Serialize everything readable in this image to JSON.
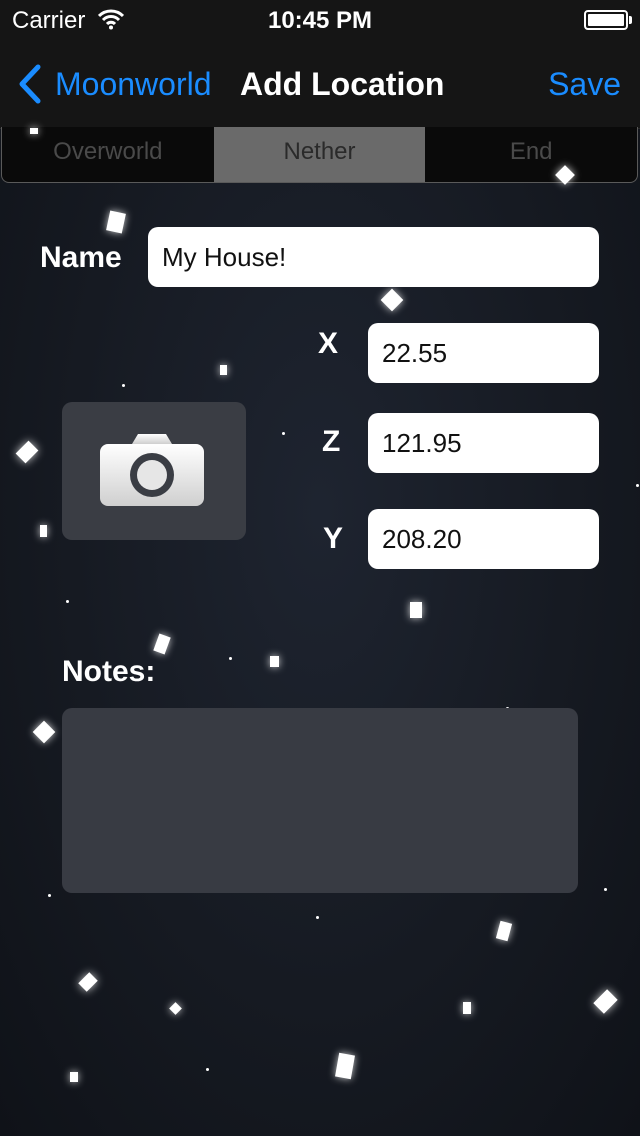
{
  "status_bar": {
    "carrier": "Carrier",
    "time": "10:45 PM"
  },
  "nav": {
    "back_label": "Moonworld",
    "title": "Add Location",
    "save_label": "Save"
  },
  "segments": {
    "overworld": "Overworld",
    "nether": "Nether",
    "end": "End",
    "selected": "Nether"
  },
  "form": {
    "name_label": "Name",
    "name_value": "My House!",
    "x_label": "X",
    "x_value": "22.55",
    "z_label": "Z",
    "z_value": "121.95",
    "y_label": "Y",
    "y_value": "208.20",
    "notes_label": "Notes:",
    "notes_value": ""
  },
  "icons": {
    "back": "chevron-left-icon",
    "photo": "camera-icon",
    "wifi": "wifi-icon",
    "battery": "battery-icon"
  },
  "colors": {
    "accent": "#1a8cff",
    "bar": "#151515",
    "segment_selected": "#6a6a6a",
    "panel": "#383b43"
  }
}
